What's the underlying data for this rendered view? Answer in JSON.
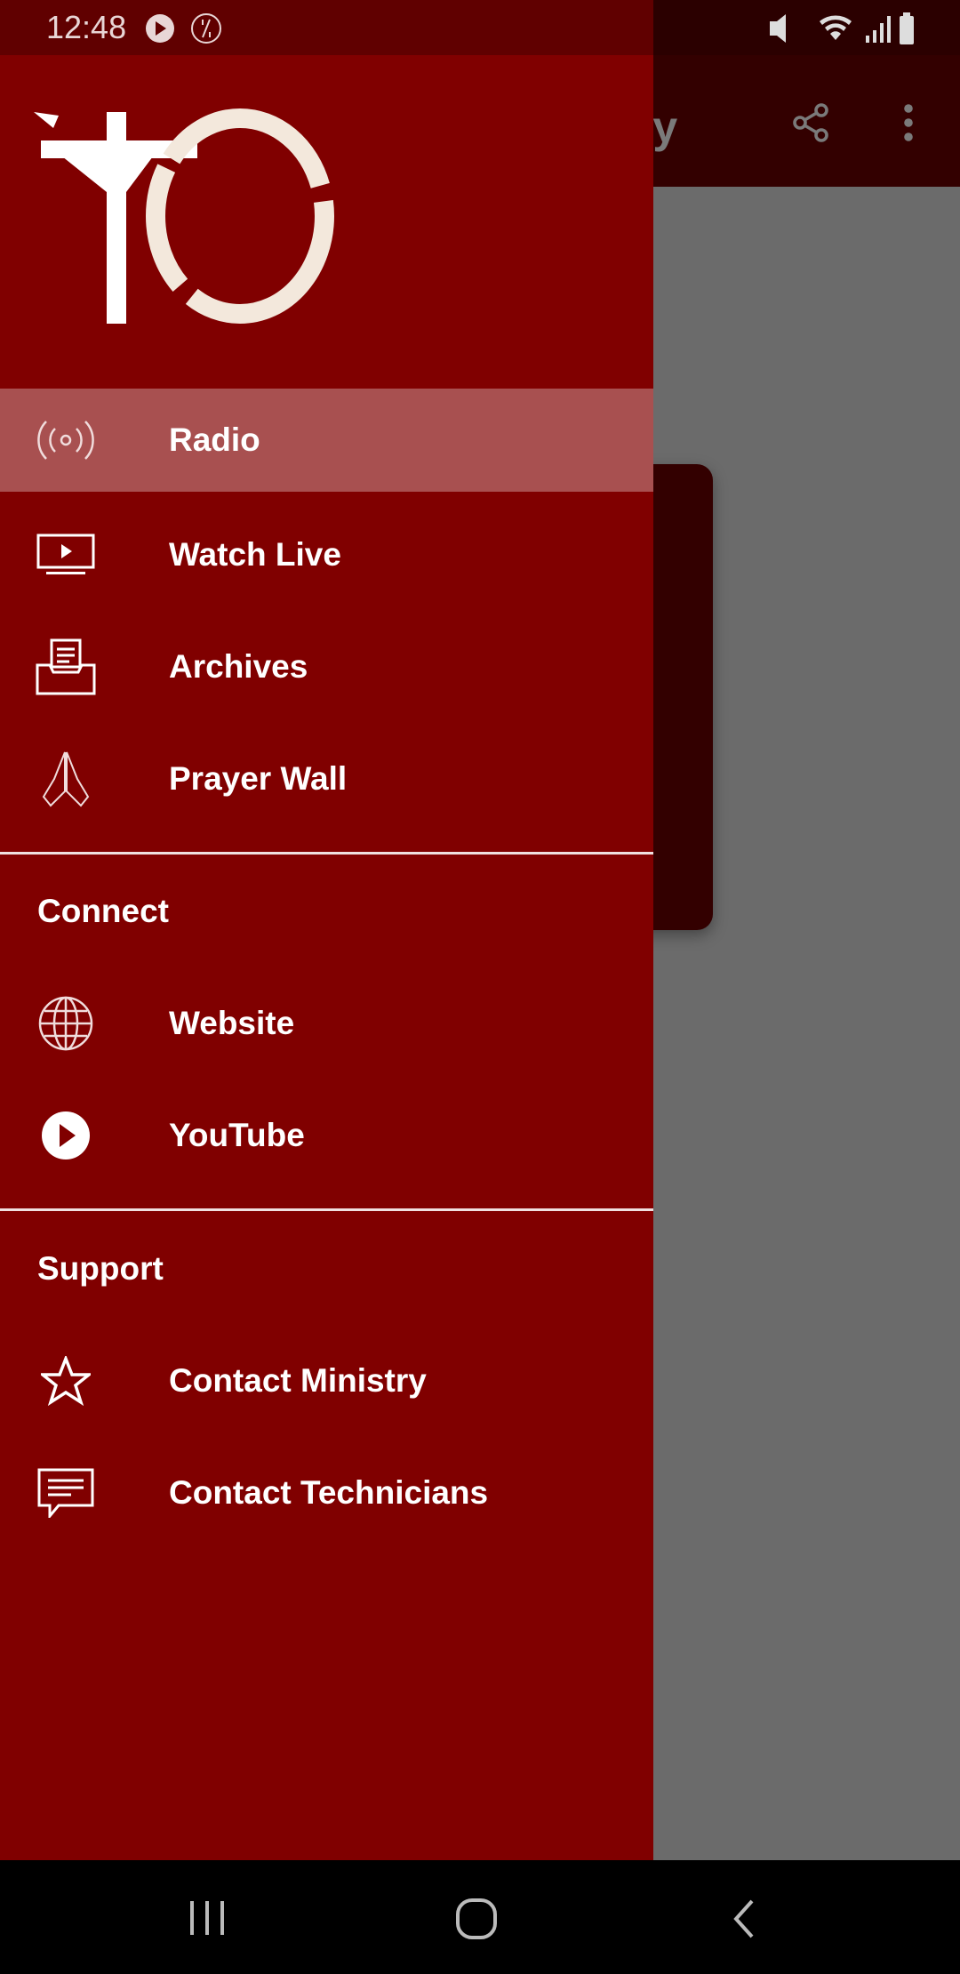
{
  "status_bar": {
    "time": "12:48",
    "left_icons": [
      "play-circle-icon",
      "sync-icon"
    ],
    "right_icons": [
      "mute-vibrate-icon",
      "wifi-icon",
      "signal-icon",
      "battery-icon"
    ]
  },
  "app_bar": {
    "title_partial": "ply",
    "actions": [
      "share-icon",
      "more-vert-icon"
    ]
  },
  "colors": {
    "drawer": "#800000",
    "selected": "#a85050",
    "app_bar": "#330000",
    "content": "#6b6b6b"
  },
  "drawer": {
    "items": [
      {
        "label": "Radio",
        "icon": "radio-broadcast-icon",
        "selected": true
      },
      {
        "label": "Watch Live",
        "icon": "tv-play-icon"
      },
      {
        "label": "Archives",
        "icon": "archive-tray-icon"
      },
      {
        "label": "Prayer Wall",
        "icon": "praying-hands-icon"
      }
    ],
    "connect": {
      "header": "Connect",
      "items": [
        {
          "label": "Website",
          "icon": "globe-icon"
        },
        {
          "label": "YouTube",
          "icon": "play-circle-icon"
        }
      ]
    },
    "support": {
      "header": "Support",
      "items": [
        {
          "label": "Contact Ministry",
          "icon": "star-icon"
        },
        {
          "label": "Contact Technicians",
          "icon": "chat-message-icon"
        }
      ]
    }
  },
  "nav_bar": {
    "buttons": [
      "recents-button",
      "home-button",
      "back-button"
    ]
  }
}
